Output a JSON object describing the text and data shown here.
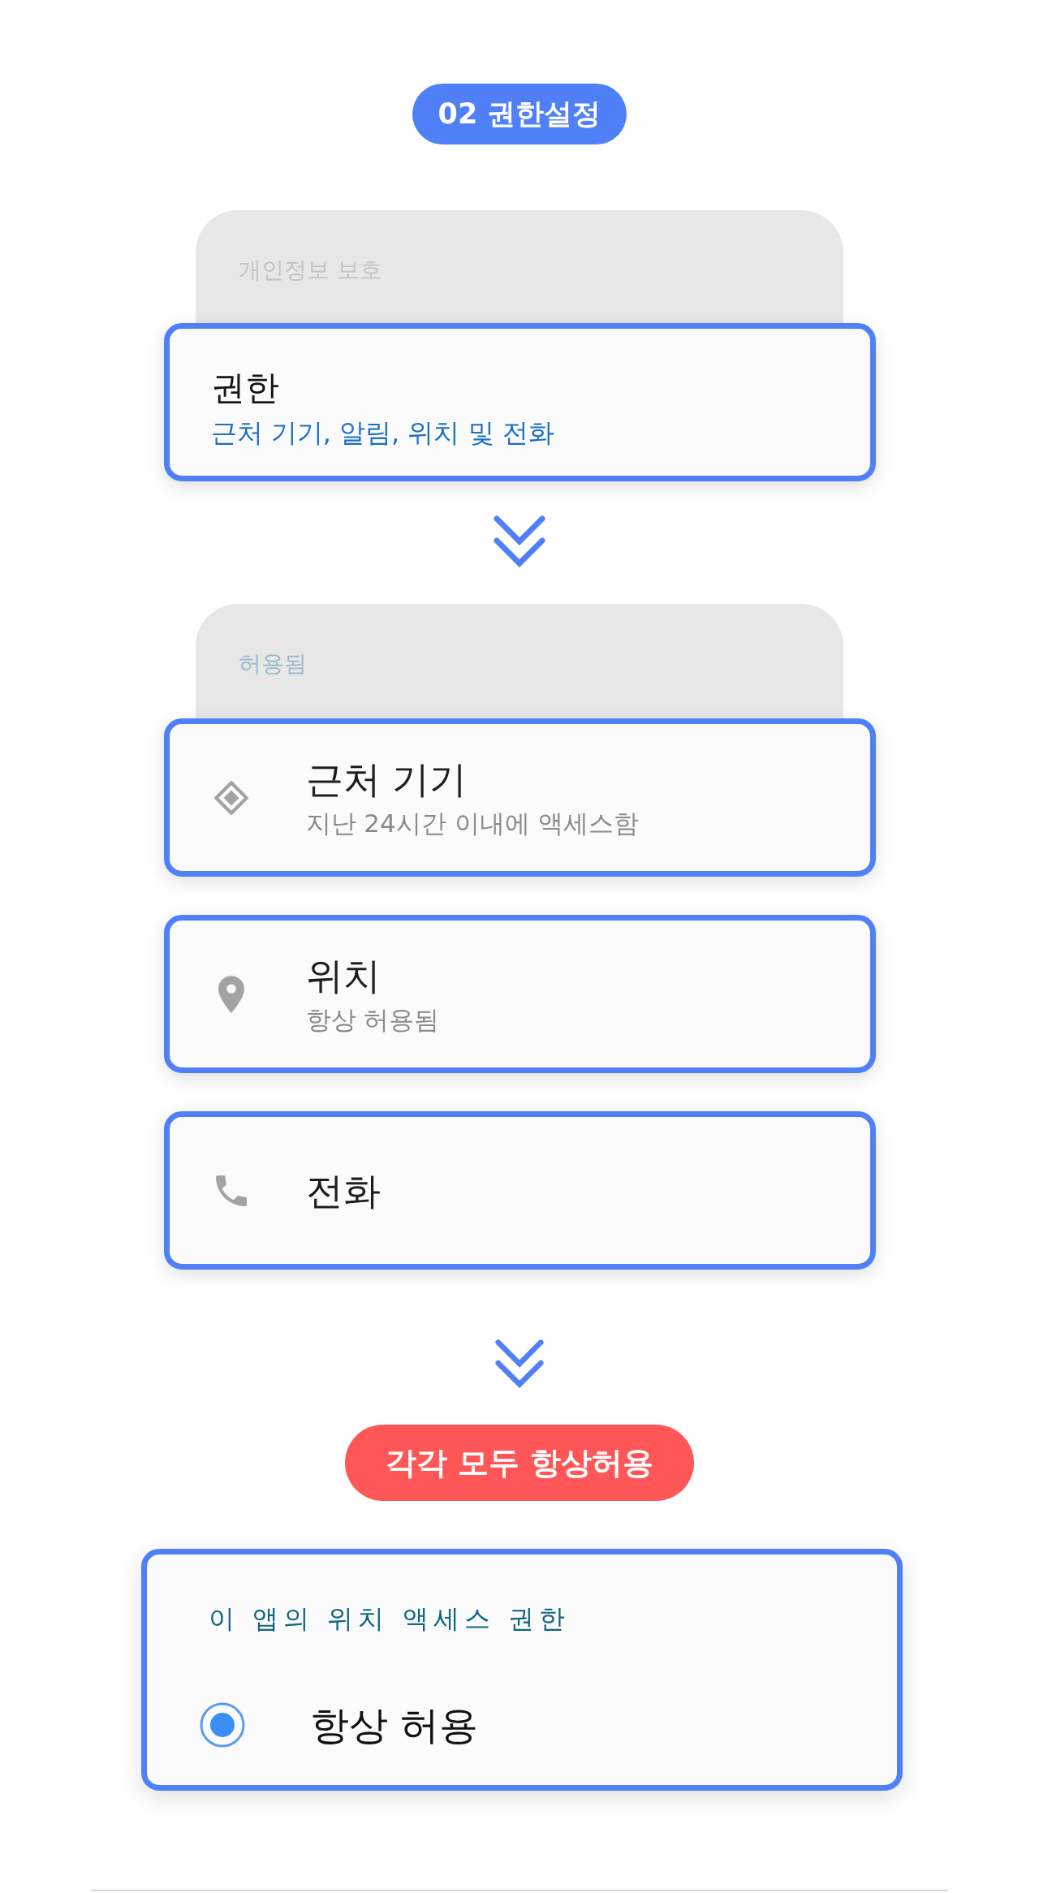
{
  "step_badge": {
    "label": "02 권한설정"
  },
  "privacy_section": {
    "header": "개인정보 보호",
    "items": [
      {
        "kind": "summary",
        "title": "권한",
        "subtitle": "근처 기기, 알림, 위치 및 전화"
      }
    ]
  },
  "allowed_section": {
    "header": "허용됨",
    "items": [
      {
        "kind": "nearby",
        "title": "근처 기기",
        "subtitle": "지난 24시간 이내에 액세스함"
      },
      {
        "kind": "location",
        "title": "위치",
        "subtitle": "항상 허용됨"
      },
      {
        "kind": "phone",
        "title": "전화"
      }
    ]
  },
  "callout": {
    "label": "각각 모두 항상허용"
  },
  "location_dialog": {
    "title": "이 앱의 위치 액세스 권한",
    "options": [
      {
        "label": "항상 허용",
        "selected": true
      }
    ]
  }
}
